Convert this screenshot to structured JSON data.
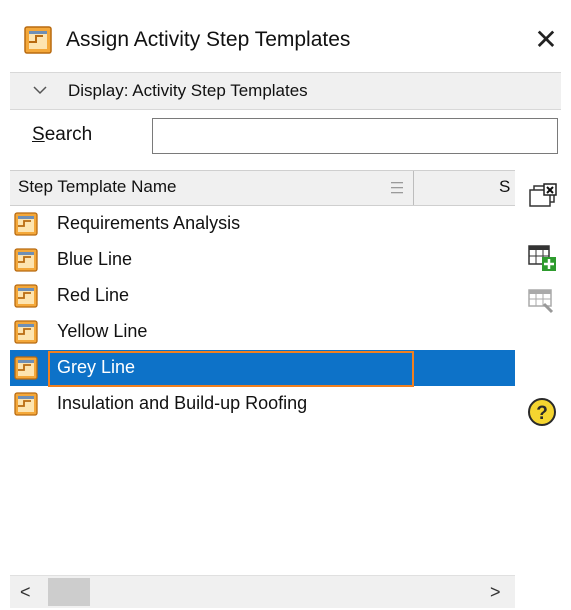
{
  "window": {
    "title": "Assign Activity Step Templates",
    "close_glyph": "✕"
  },
  "display_bar": {
    "label": "Display: Activity Step Templates"
  },
  "search": {
    "label_first": "S",
    "label_rest": "earch",
    "value": ""
  },
  "grid": {
    "columns": [
      "Step Template Name",
      "S"
    ],
    "rows": [
      {
        "name": "Requirements Analysis",
        "selected": false
      },
      {
        "name": "Blue Line",
        "selected": false
      },
      {
        "name": "Red Line",
        "selected": false
      },
      {
        "name": "Yellow Line",
        "selected": false
      },
      {
        "name": "Grey Line",
        "selected": true
      },
      {
        "name": "Insulation and Build-up Roofing",
        "selected": false
      }
    ]
  },
  "scrollbar": {
    "left_arrow": "<",
    "right_arrow": ">"
  },
  "side_toolbar": {
    "icons": [
      "assign-remove-icon",
      "add-step-template-icon",
      "edit-step-template-icon",
      "help-icon"
    ],
    "help_glyph": "?"
  },
  "colors": {
    "selection": "#0d72c8",
    "focus_border": "#f08020",
    "icon_orange": "#f0a030"
  }
}
